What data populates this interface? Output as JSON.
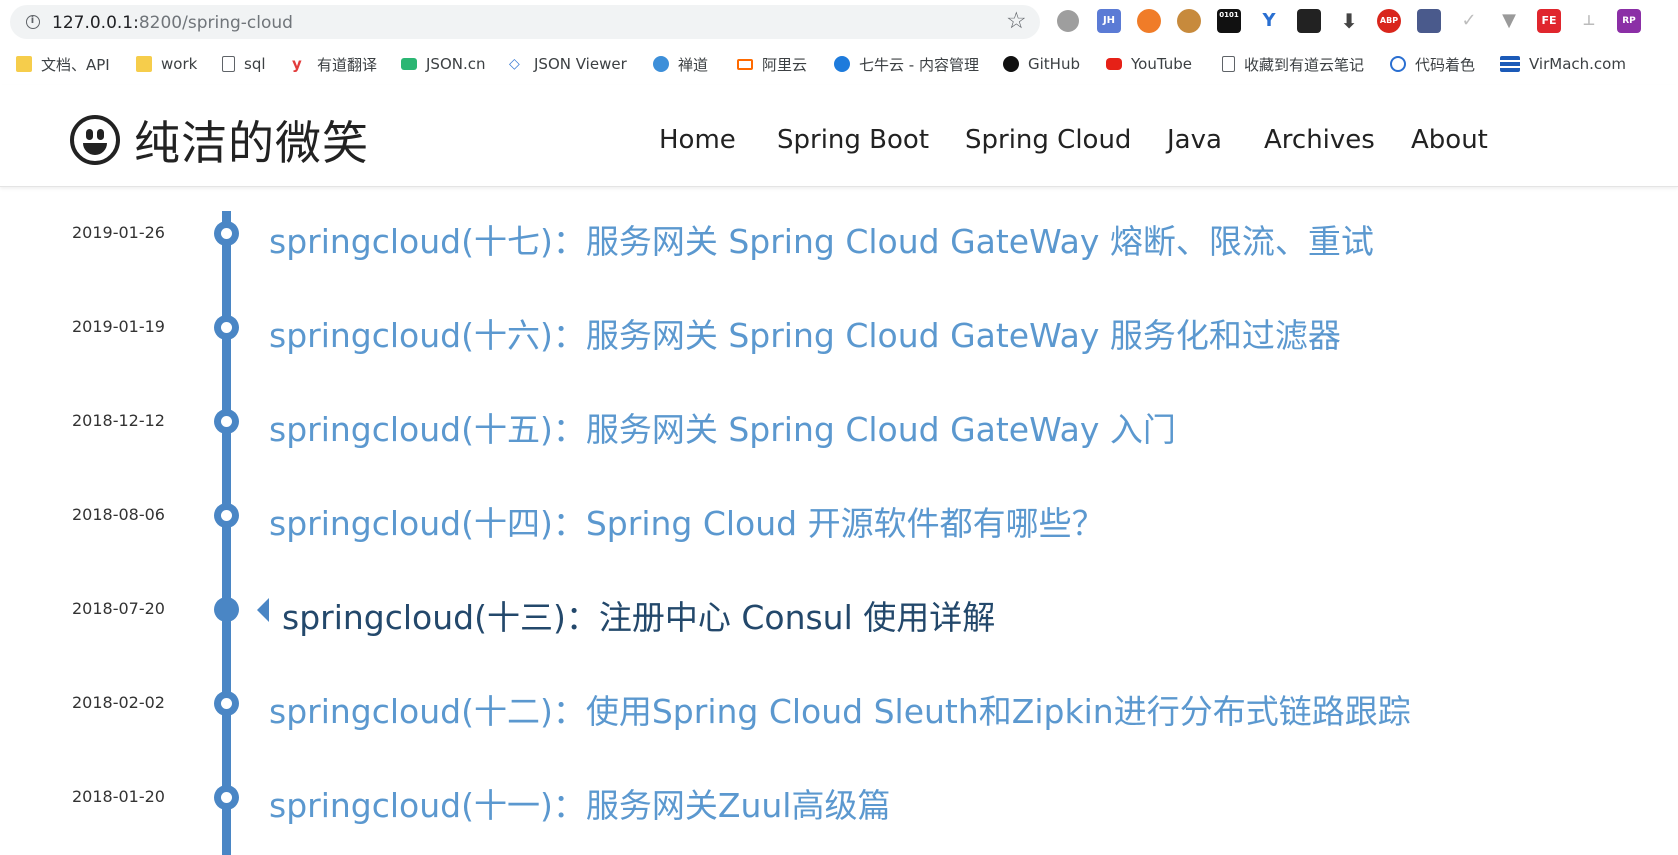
{
  "browser": {
    "url_host": "127.0.0.1:",
    "url_rest": "8200/spring-cloud",
    "extensions": [
      {
        "name": "gray-circle-extension-icon",
        "label": "",
        "color": "#9e9e9e"
      },
      {
        "name": "jh-extension-icon",
        "label": "JH",
        "color": "#5b7bd5"
      },
      {
        "name": "orange-lifebuoy-extension-icon",
        "label": "",
        "color": "#f07c28"
      },
      {
        "name": "cookie-extension-icon",
        "label": "",
        "color": "#c78a3c"
      },
      {
        "name": "binary-extension-icon",
        "label": "0101",
        "color": "#111111"
      },
      {
        "name": "y-extension-icon",
        "label": "Y",
        "color": "#2a6fd1"
      },
      {
        "name": "mask-extension-icon",
        "label": "",
        "color": "#222222"
      },
      {
        "name": "download-arrow-extension-icon",
        "label": "",
        "color": "#444444"
      },
      {
        "name": "abp-extension-icon",
        "label": "ABP",
        "color": "#d9261c"
      },
      {
        "name": "grid-extension-icon",
        "label": "",
        "color": "#4a5a8c"
      },
      {
        "name": "check-extension-icon",
        "label": "",
        "color": "#bdbdbd"
      },
      {
        "name": "vue-extension-icon",
        "label": "",
        "color": "#9a9a9a"
      },
      {
        "name": "fe-extension-icon",
        "label": "FE",
        "color": "#e0262d"
      },
      {
        "name": "sitemap-extension-icon",
        "label": "",
        "color": "#bbbbbb"
      },
      {
        "name": "rp-extension-icon",
        "label": "RP",
        "color": "#8b2fa6"
      }
    ]
  },
  "bookmarks": [
    {
      "label": "文档、API",
      "icon": "folder-icon"
    },
    {
      "label": "work",
      "icon": "folder-icon"
    },
    {
      "label": "sql",
      "icon": "page-icon"
    },
    {
      "label": "有道翻译",
      "icon": "youdao-icon"
    },
    {
      "label": "JSON.cn",
      "icon": "json-icon"
    },
    {
      "label": "JSON Viewer",
      "icon": "json-viewer-icon"
    },
    {
      "label": "禅道",
      "icon": "zentao-icon"
    },
    {
      "label": "阿里云",
      "icon": "aliyun-icon"
    },
    {
      "label": "七牛云 - 内容管理",
      "icon": "qiniu-icon"
    },
    {
      "label": "GitHub",
      "icon": "github-icon"
    },
    {
      "label": "YouTube",
      "icon": "youtube-icon"
    },
    {
      "label": "收藏到有道云笔记",
      "icon": "page-icon"
    },
    {
      "label": "代码着色",
      "icon": "code-color-icon"
    },
    {
      "label": "VirMach.com",
      "icon": "virmach-icon"
    }
  ],
  "site": {
    "title": "纯洁的微笑",
    "nav": [
      "Home",
      "Spring Boot",
      "Spring Cloud",
      "Java",
      "Archives",
      "About"
    ]
  },
  "posts": [
    {
      "date": "2019-01-26",
      "title": "springcloud(十七)：服务网关 Spring Cloud GateWay 熔断、限流、重试"
    },
    {
      "date": "2019-01-19",
      "title": "springcloud(十六)：服务网关 Spring Cloud GateWay 服务化和过滤器"
    },
    {
      "date": "2018-12-12",
      "title": "springcloud(十五)：服务网关 Spring Cloud GateWay 入门"
    },
    {
      "date": "2018-08-06",
      "title": "springcloud(十四)：Spring Cloud 开源软件都有哪些？"
    },
    {
      "date": "2018-07-20",
      "title": "springcloud(十三)：注册中心 Consul 使用详解"
    },
    {
      "date": "2018-02-02",
      "title": "springcloud(十二)：使用Spring Cloud Sleuth和Zipkin进行分布式链路跟踪"
    },
    {
      "date": "2018-01-20",
      "title": "springcloud(十一)：服务网关Zuul高级篇"
    }
  ],
  "colors": {
    "accent": "#4a86c5",
    "link": "#5b98cf",
    "active_link": "#23486b"
  }
}
